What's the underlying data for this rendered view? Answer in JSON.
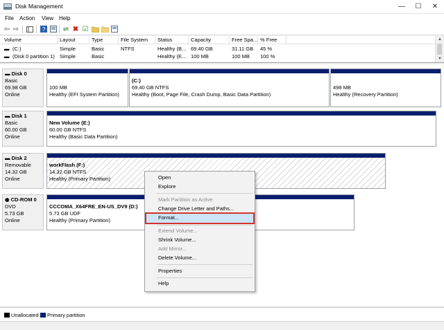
{
  "window": {
    "title": "Disk Management",
    "controls": [
      "minimize",
      "maximize",
      "close"
    ]
  },
  "menu": [
    "File",
    "Action",
    "View",
    "Help"
  ],
  "toolbar": {
    "icons": [
      "back-icon",
      "forward-icon",
      "console-tree-icon",
      "help-icon",
      "properties-icon",
      "connect-icon",
      "delete-icon",
      "check-icon",
      "folder-icon",
      "folder-open-icon",
      "show-icon"
    ]
  },
  "volumes": {
    "columns": [
      "Volume",
      "Layout",
      "Type",
      "File System",
      "Status",
      "Capacity",
      "Free Spa...",
      "% Free"
    ],
    "rows": [
      [
        "(C:)",
        "Simple",
        "Basic",
        "NTFS",
        "Healthy (B...",
        "69.40 GB",
        "31.11 GB",
        "45 %"
      ],
      [
        "(Disk 0 partition 1)",
        "Simple",
        "Basic",
        "",
        "Healthy (E...",
        "100 MB",
        "100 MB",
        "100 %"
      ]
    ]
  },
  "disks": [
    {
      "name": "Disk 0",
      "kind": "Basic",
      "size": "69.98 GB",
      "state": "Online",
      "partitions": [
        {
          "name": "",
          "detail": "100 MB",
          "status": "Healthy (EFI System Partition)"
        },
        {
          "name": "(C:)",
          "detail": "69.40 GB NTFS",
          "status": "Healthy (Boot, Page File, Crash Dump, Basic Data Partition)"
        },
        {
          "name": "",
          "detail": "498 MB",
          "status": "Healthy (Recovery Partition)"
        }
      ]
    },
    {
      "name": "Disk 1",
      "kind": "Basic",
      "size": "60.00 GB",
      "state": "Online",
      "partitions": [
        {
          "name": "New Volume  (E:)",
          "detail": "60.00 GB NTFS",
          "status": "Healthy (Basic Data Partition)"
        }
      ]
    },
    {
      "name": "Disk 2",
      "kind": "Removable",
      "size": "14.32 GB",
      "state": "Online",
      "partitions": [
        {
          "name": "workFlash  (F:)",
          "detail": "14.32 GB NTFS",
          "status": "Healthy (Primary Partition)"
        }
      ]
    },
    {
      "name": "CD-ROM 0",
      "kind": "DVD",
      "size": "5.73 GB",
      "state": "Online",
      "partitions": [
        {
          "name": "CCCOMA_X64FRE_EN-US_DV9  (D:)",
          "detail": "5.73 GB UDF",
          "status": "Healthy (Primary Partition)"
        }
      ]
    }
  ],
  "context_menu": {
    "items": [
      {
        "label": "Open",
        "enabled": true
      },
      {
        "label": "Explore",
        "enabled": true
      },
      {
        "label": "Mark Partition as Active",
        "enabled": false
      },
      {
        "label": "Change Drive Letter and Paths...",
        "enabled": true
      },
      {
        "label": "Format...",
        "enabled": true,
        "highlighted": true
      },
      {
        "label": "Extend Volume...",
        "enabled": false
      },
      {
        "label": "Shrink Volume...",
        "enabled": true
      },
      {
        "label": "Add Mirror...",
        "enabled": false
      },
      {
        "label": "Delete Volume...",
        "enabled": true
      },
      {
        "label": "Properties",
        "enabled": true
      },
      {
        "label": "Help",
        "enabled": true
      }
    ]
  },
  "legend": [
    {
      "label": "Unallocated",
      "color": "#000000"
    },
    {
      "label": "Primary partition",
      "color": "#0a1e6e"
    }
  ],
  "colors": {
    "partition_bar": "#0a1e6e",
    "highlight_border": "#d23232",
    "highlight_bg": "#cce4f7"
  }
}
